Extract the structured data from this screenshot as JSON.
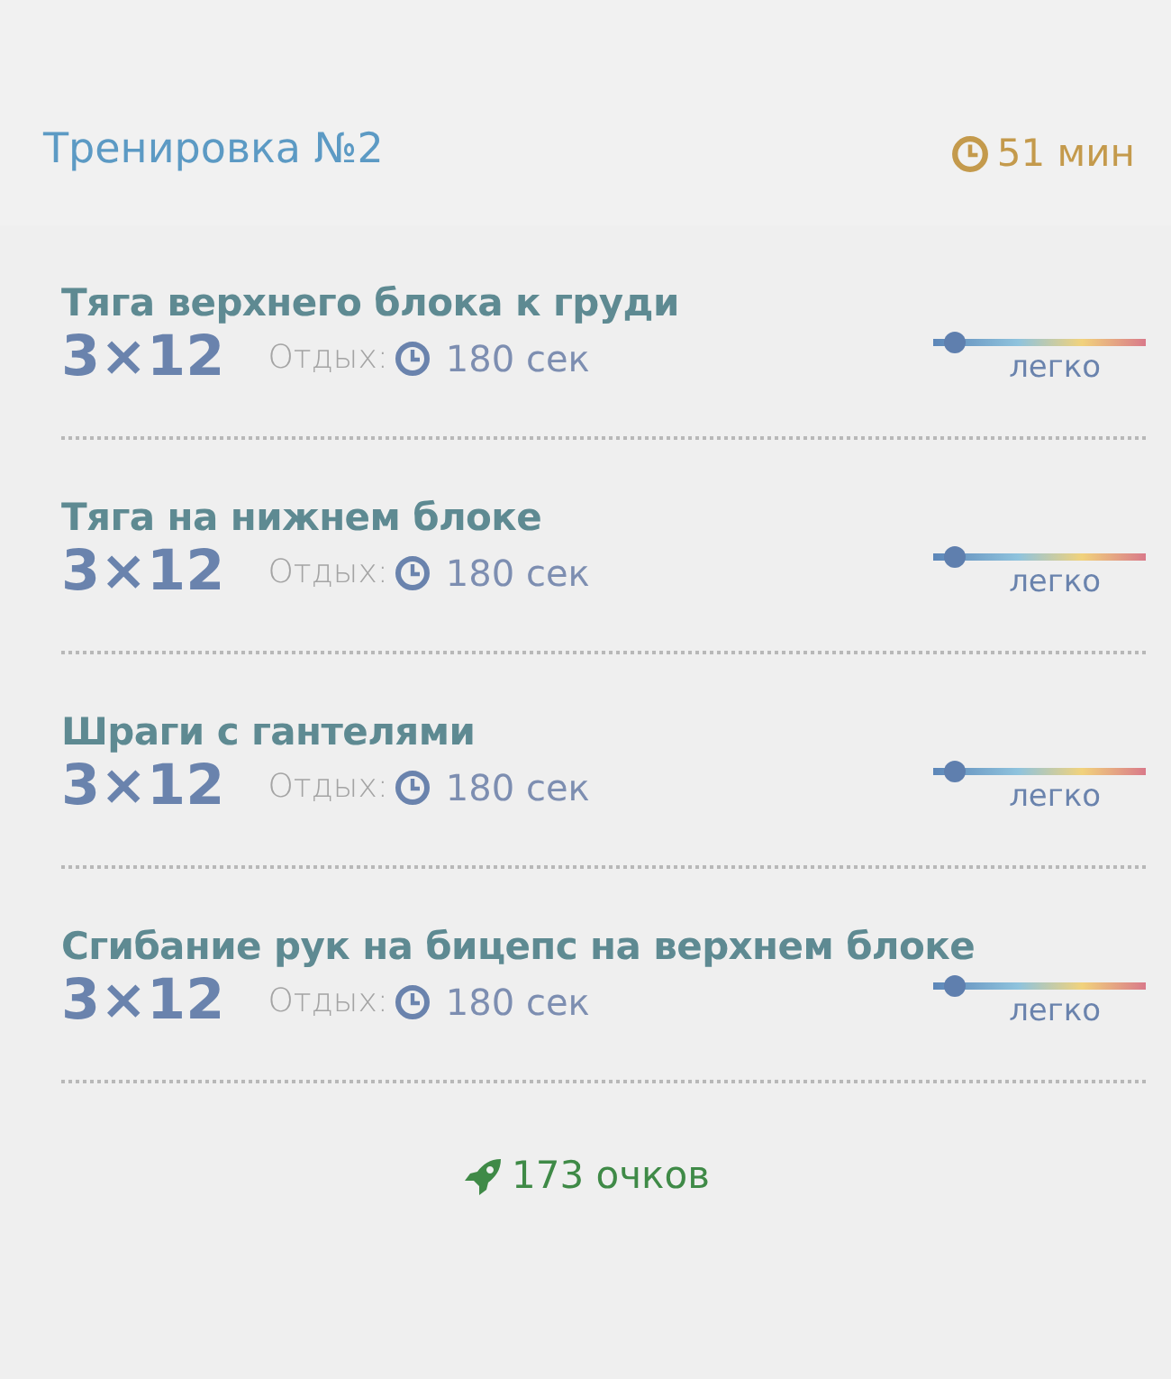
{
  "title": "Тренировка №2",
  "duration": "51 мин",
  "exercises": [
    {
      "name": "Тяга верхнего блока к груди",
      "sets": "3×12",
      "rest_label": "Отдых:",
      "rest": "180 сек",
      "difficulty": {
        "level": 0.1,
        "label": "легко"
      }
    },
    {
      "name": "Тяга на нижнем блоке",
      "sets": "3×12",
      "rest_label": "Отдых:",
      "rest": "180 сек",
      "difficulty": {
        "level": 0.1,
        "label": "легко"
      }
    },
    {
      "name": "Шраги с гантелями",
      "sets": "3×12",
      "rest_label": "Отдых:",
      "rest": "180 сек",
      "difficulty": {
        "level": 0.1,
        "label": "легко"
      }
    },
    {
      "name": "Сгибание рук на бицепс на верхнем блоке",
      "sets": "3×12",
      "rest_label": "Отдых:",
      "rest": "180 сек",
      "difficulty": {
        "level": 0.1,
        "label": "легко"
      }
    }
  ],
  "points": "173 очков"
}
